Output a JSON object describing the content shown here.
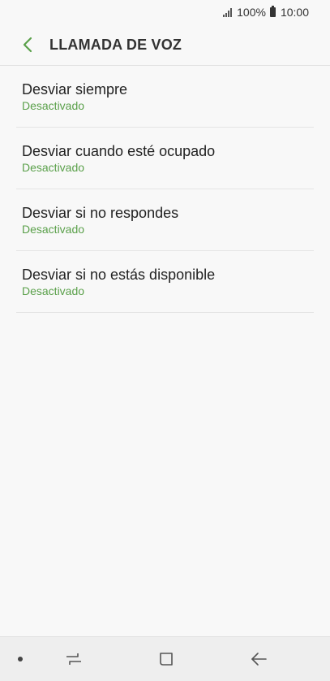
{
  "status_bar": {
    "battery": "100%",
    "time": "10:00"
  },
  "header": {
    "title": "LLAMADA DE VOZ"
  },
  "settings": [
    {
      "title": "Desviar siempre",
      "status": "Desactivado"
    },
    {
      "title": "Desviar cuando esté ocupado",
      "status": "Desactivado"
    },
    {
      "title": "Desviar si no respondes",
      "status": "Desactivado"
    },
    {
      "title": "Desviar si no estás disponible",
      "status": "Desactivado"
    }
  ],
  "colors": {
    "accent": "#5aa04a",
    "background": "#f8f8f8"
  },
  "icons": {
    "back": "chevron-left-icon",
    "recents": "recents-icon",
    "home": "home-icon",
    "nav_back": "arrow-back-icon"
  }
}
